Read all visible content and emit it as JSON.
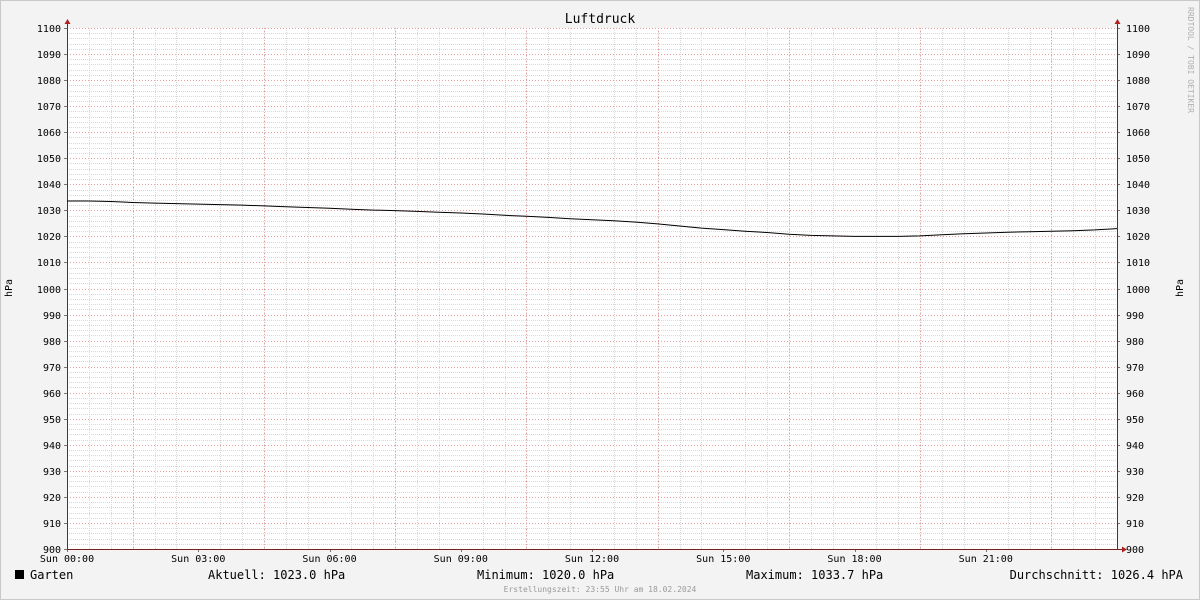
{
  "chart_data": {
    "type": "line",
    "title": "Luftdruck",
    "ylabel": "hPa",
    "ylabel_right": "hPa",
    "ylim": [
      900,
      1100
    ],
    "y_ticks": [
      900,
      910,
      920,
      930,
      940,
      950,
      960,
      970,
      980,
      990,
      1000,
      1010,
      1020,
      1030,
      1040,
      1050,
      1060,
      1070,
      1080,
      1090,
      1100
    ],
    "xlim_hours": [
      0,
      24
    ],
    "x_ticks": [
      {
        "hour": 0,
        "label": "Sun 00:00"
      },
      {
        "hour": 3,
        "label": "Sun 03:00"
      },
      {
        "hour": 6,
        "label": "Sun 06:00"
      },
      {
        "hour": 9,
        "label": "Sun 09:00"
      },
      {
        "hour": 12,
        "label": "Sun 12:00"
      },
      {
        "hour": 15,
        "label": "Sun 15:00"
      },
      {
        "hour": 18,
        "label": "Sun 18:00"
      },
      {
        "hour": 21,
        "label": "Sun 21:00"
      }
    ],
    "grid": true,
    "series": [
      {
        "name": "Garten",
        "color": "#000000",
        "x": [
          0,
          0.5,
          1,
          1.5,
          2,
          2.5,
          3,
          3.5,
          4,
          4.5,
          5,
          5.5,
          6,
          6.5,
          7,
          7.5,
          8,
          8.5,
          9,
          9.5,
          10,
          10.5,
          11,
          11.5,
          12,
          12.5,
          13,
          13.5,
          14,
          14.5,
          15,
          15.5,
          16,
          16.5,
          17,
          17.5,
          18,
          18.5,
          19,
          19.5,
          20,
          20.5,
          21,
          21.5,
          22,
          22.5,
          23,
          23.5,
          24
        ],
        "values": [
          1033.6,
          1033.6,
          1033.4,
          1033.0,
          1032.8,
          1032.6,
          1032.4,
          1032.2,
          1032.0,
          1031.7,
          1031.4,
          1031.1,
          1030.8,
          1030.4,
          1030.1,
          1029.9,
          1029.6,
          1029.3,
          1029.0,
          1028.6,
          1028.1,
          1027.7,
          1027.3,
          1026.8,
          1026.4,
          1026.0,
          1025.5,
          1024.8,
          1024.0,
          1023.2,
          1022.6,
          1022.0,
          1021.5,
          1020.8,
          1020.4,
          1020.2,
          1020.0,
          1020.0,
          1020.0,
          1020.2,
          1020.6,
          1021.0,
          1021.3,
          1021.6,
          1021.8,
          1022.0,
          1022.2,
          1022.5,
          1023.0
        ]
      }
    ]
  },
  "legend": {
    "swatch_color": "#000000",
    "series_name": "Garten",
    "current": "Aktuell: 1023.0 hPa",
    "minimum": "Minimum: 1020.0 hPa",
    "maximum": "Maximum: 1033.7 hPa",
    "average": "Durchschnitt: 1026.4 hPA"
  },
  "footer": "Erstellungszeit: 23:55 Uhr am 18.02.2024",
  "watermark": "RRDTOOL / TOBI OETIKER"
}
